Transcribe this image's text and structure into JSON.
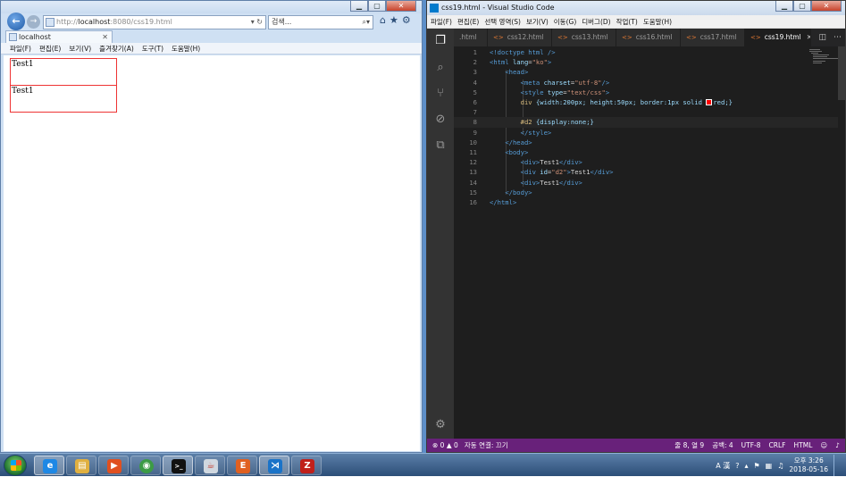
{
  "ie": {
    "address": {
      "prefix": "http://",
      "host": "localhost",
      "rest": ":8080/css19.html",
      "dropdown": "▾",
      "refresh": "↻"
    },
    "search": {
      "placeholder": "검색...",
      "icon": "⌕▾"
    },
    "tab": {
      "label": "localhost",
      "close": "✕"
    },
    "menu": [
      "파일(F)",
      "편집(E)",
      "보기(V)",
      "즐겨찾기(A)",
      "도구(T)",
      "도움말(H)"
    ],
    "content": {
      "div1_text": "Test1",
      "div2_text": "Test1"
    }
  },
  "vscode": {
    "title": "css19.html - Visual Studio Code",
    "menu": [
      "파일(F)",
      "편집(E)",
      "선택 영역(S)",
      "보기(V)",
      "이동(G)",
      "디버그(D)",
      "작업(T)",
      "도움말(H)"
    ],
    "tabs": [
      {
        "label": ".html",
        "active": false
      },
      {
        "label": "css12.html",
        "active": false
      },
      {
        "label": "css13.html",
        "active": false
      },
      {
        "label": "css16.html",
        "active": false
      },
      {
        "label": "css17.html",
        "active": false
      },
      {
        "label": "css19.html",
        "active": true
      }
    ],
    "tab_close": "✕",
    "code_lines": [
      "1",
      "2",
      "3",
      "4",
      "5",
      "6",
      "7",
      "8",
      "9",
      "10",
      "11",
      "12",
      "13",
      "14",
      "15",
      "16"
    ],
    "code": {
      "l1_a": "<!doctype html />",
      "l2_tag": "<html",
      "l2_attr": "lang",
      "l2_val": "\"ko\"",
      "l2_end": ">",
      "l3": "<head>",
      "l4_tag": "<meta",
      "l4_attr": "charset",
      "l4_val": "\"utf-8\"",
      "l4_end": "/>",
      "l5_tag": "<style",
      "l5_attr": "type",
      "l5_val": "\"text/css\"",
      "l5_end": ">",
      "l6_sel": "div",
      "l6_body1": "{width:200px; height:50px; border:1px solid ",
      "l6_body2": "red;}",
      "l8_sel": "#d2",
      "l8_body": "{display:none;}",
      "l9": "</style>",
      "l10": "</head>",
      "l11": "<body>",
      "l12_open": "<div>",
      "l12_text": "Test1",
      "l12_close": "</div>",
      "l13_tag": "<div",
      "l13_attr": "id",
      "l13_val": "\"d2\"",
      "l13_open_end": ">",
      "l13_text": "Test1",
      "l13_close": "</div>",
      "l14_open": "<div>",
      "l14_text": "Test1",
      "l14_close": "</div>",
      "l15": "</body>",
      "l16": "</html>"
    },
    "status": {
      "problems": "⊗ 0 ▲ 0",
      "autoconnect": "자동 연결: 끄기",
      "position": "줄 8, 열 9",
      "spaces": "공백: 4",
      "encoding": "UTF-8",
      "eol": "CRLF",
      "language": "HTML",
      "smiley": "☺",
      "bell": "🔔"
    }
  },
  "taskbar": {
    "apps": [
      {
        "icon": "ie-icon",
        "glyph": "e",
        "color": "#1e88e5"
      },
      {
        "icon": "folder-icon",
        "glyph": "▤",
        "color": "#e0b040"
      },
      {
        "icon": "media-player-icon",
        "glyph": "▶",
        "color": "#e05020"
      },
      {
        "icon": "chrome-icon",
        "glyph": "◉",
        "color": "#3c9b45"
      },
      {
        "icon": "cmd-icon",
        "glyph": ">_",
        "color": "#111111"
      },
      {
        "icon": "java-icon",
        "glyph": "☕",
        "color": "#d0d8e0"
      },
      {
        "icon": "editplus-icon",
        "glyph": "E",
        "color": "#e06020"
      },
      {
        "icon": "vscode-icon",
        "glyph": "⋊",
        "color": "#1a73c8"
      },
      {
        "icon": "filezilla-icon",
        "glyph": "Z",
        "color": "#c0201a"
      }
    ],
    "tray": {
      "lang": "A 漢",
      "time": "오후 3:26",
      "date": "2018-05-16"
    }
  }
}
